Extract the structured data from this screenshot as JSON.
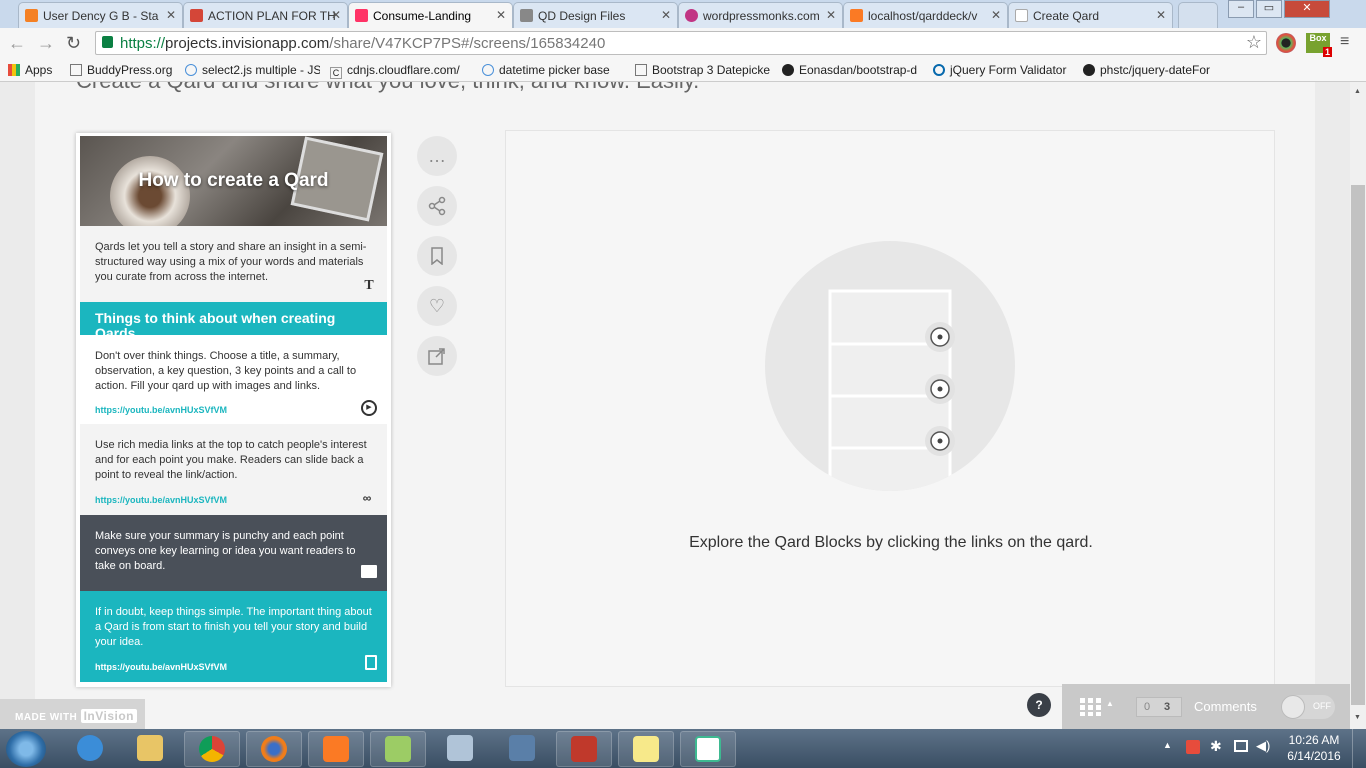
{
  "browser": {
    "tabs": [
      {
        "label": "User Dency G B - Sta",
        "color": "#f48024"
      },
      {
        "label": "ACTION PLAN FOR TH",
        "color": "#d44638"
      },
      {
        "label": "Consume-Landing",
        "color": "#ff3366"
      },
      {
        "label": "QD Design Files",
        "color": "#888888"
      },
      {
        "label": "wordpressmonks.com",
        "color": "#c13584"
      },
      {
        "label": "localhost/qarddeck/v",
        "color": "#fb7a24"
      },
      {
        "label": "Create Qard",
        "color": "#cccccc"
      }
    ],
    "url_scheme": "https://",
    "url_host": "projects.invisionapp.com",
    "url_path": "/share/V47KCP7PS#/screens/165834240",
    "bookmarks": [
      "Apps",
      "BuddyPress.org",
      "select2.js multiple - JS",
      "cdnjs.cloudflare.com/",
      "datetime picker base",
      "Bootstrap 3 Datepicke",
      "Eonasdan/bootstrap-d",
      "jQuery Form Validator",
      "phstc/jquery-dateFor"
    ],
    "ext_badge": "1"
  },
  "page": {
    "headline": "Create a Qard and share what you love, think, and know. Easily.",
    "qard": {
      "title": "How to create a Qard",
      "intro": "Qards let you tell a story and share an insight in a semi-structured way using a mix of your words and materials you curate from across the internet.",
      "section_heading": "Things to think about when creating Qards",
      "point1": "Don't over think things. Choose a title, a summary, observation, a key question, 3 key points and a call to action. Fill your qard up with images and links.",
      "point1_link": "https://youtu.be/avnHUxSVfVM",
      "point2": "Use rich media links at the top to catch people's interest and for each point you make. Readers can slide back a point to reveal the link/action.",
      "point2_link": "https://youtu.be/avnHUxSVfVM",
      "point3": "Make sure your summary is punchy and each point conveys one key learning or idea you want readers to take on board.",
      "point4": "If in doubt, keep things simple. The important thing about a Qard is from start to finish you tell your story and build your idea.",
      "point4_link": "https://youtu.be/avnHUxSVfVM"
    },
    "explore_text": "Explore the Qard Blocks by clicking the links on the qard."
  },
  "invision": {
    "made_with": "MADE WITH",
    "brand": "InVision",
    "help": "?",
    "comment_count_left": "0",
    "comment_count_right": "3",
    "comments_label": "Comments",
    "toggle_state": "OFF"
  },
  "taskbar": {
    "time": "10:26 AM",
    "date": "6/14/2016"
  }
}
